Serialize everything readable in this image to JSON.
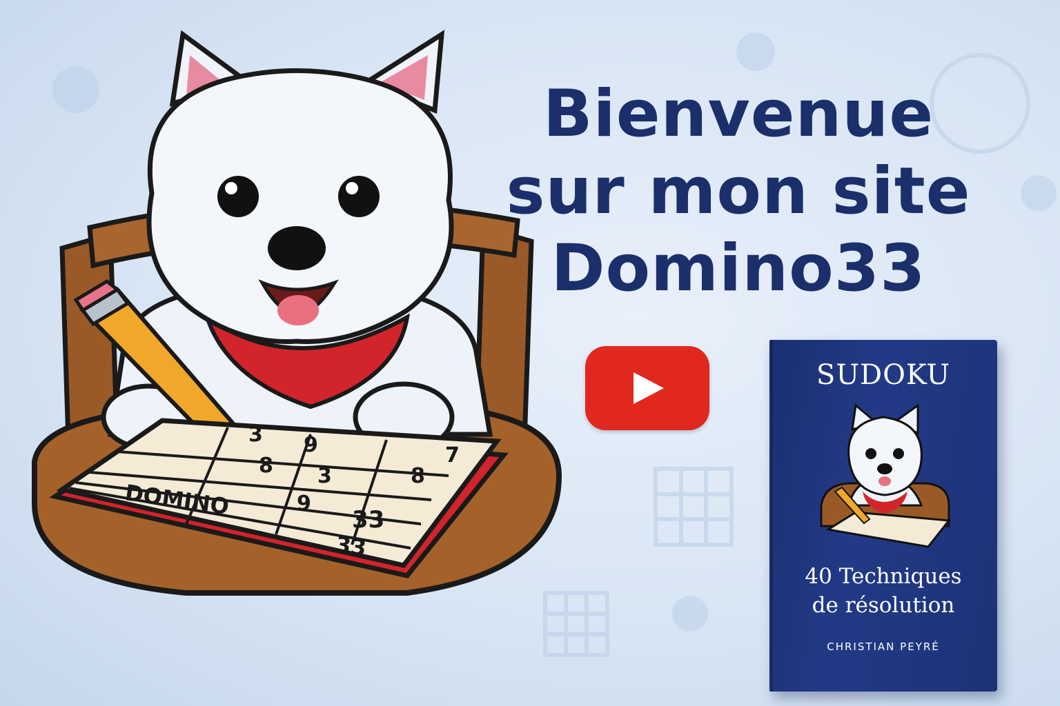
{
  "headline": {
    "line1": "Bienvenue",
    "line2": "sur mon site",
    "line3": "Domino33"
  },
  "youtube": {
    "icon": "youtube-play-icon",
    "color": "#e0281e"
  },
  "mascot": {
    "grid_numbers": [
      "3",
      "9",
      "7",
      "8",
      "3",
      "8",
      "9",
      "3"
    ],
    "grid_word": "DOMINO",
    "grid_number_33": "33",
    "grid_number_33_bottom": "33"
  },
  "book": {
    "title": "SUDOKU",
    "subtitle_line1": "40 Techniques",
    "subtitle_line2": "de résolution",
    "author": "CHRISTIAN PEYRÉ",
    "cover_color": "#1f3580"
  },
  "colors": {
    "headline": "#1b2f6b",
    "bandana": "#d2242b",
    "chair": "#8a4f22",
    "background": "#dbe7f5"
  }
}
